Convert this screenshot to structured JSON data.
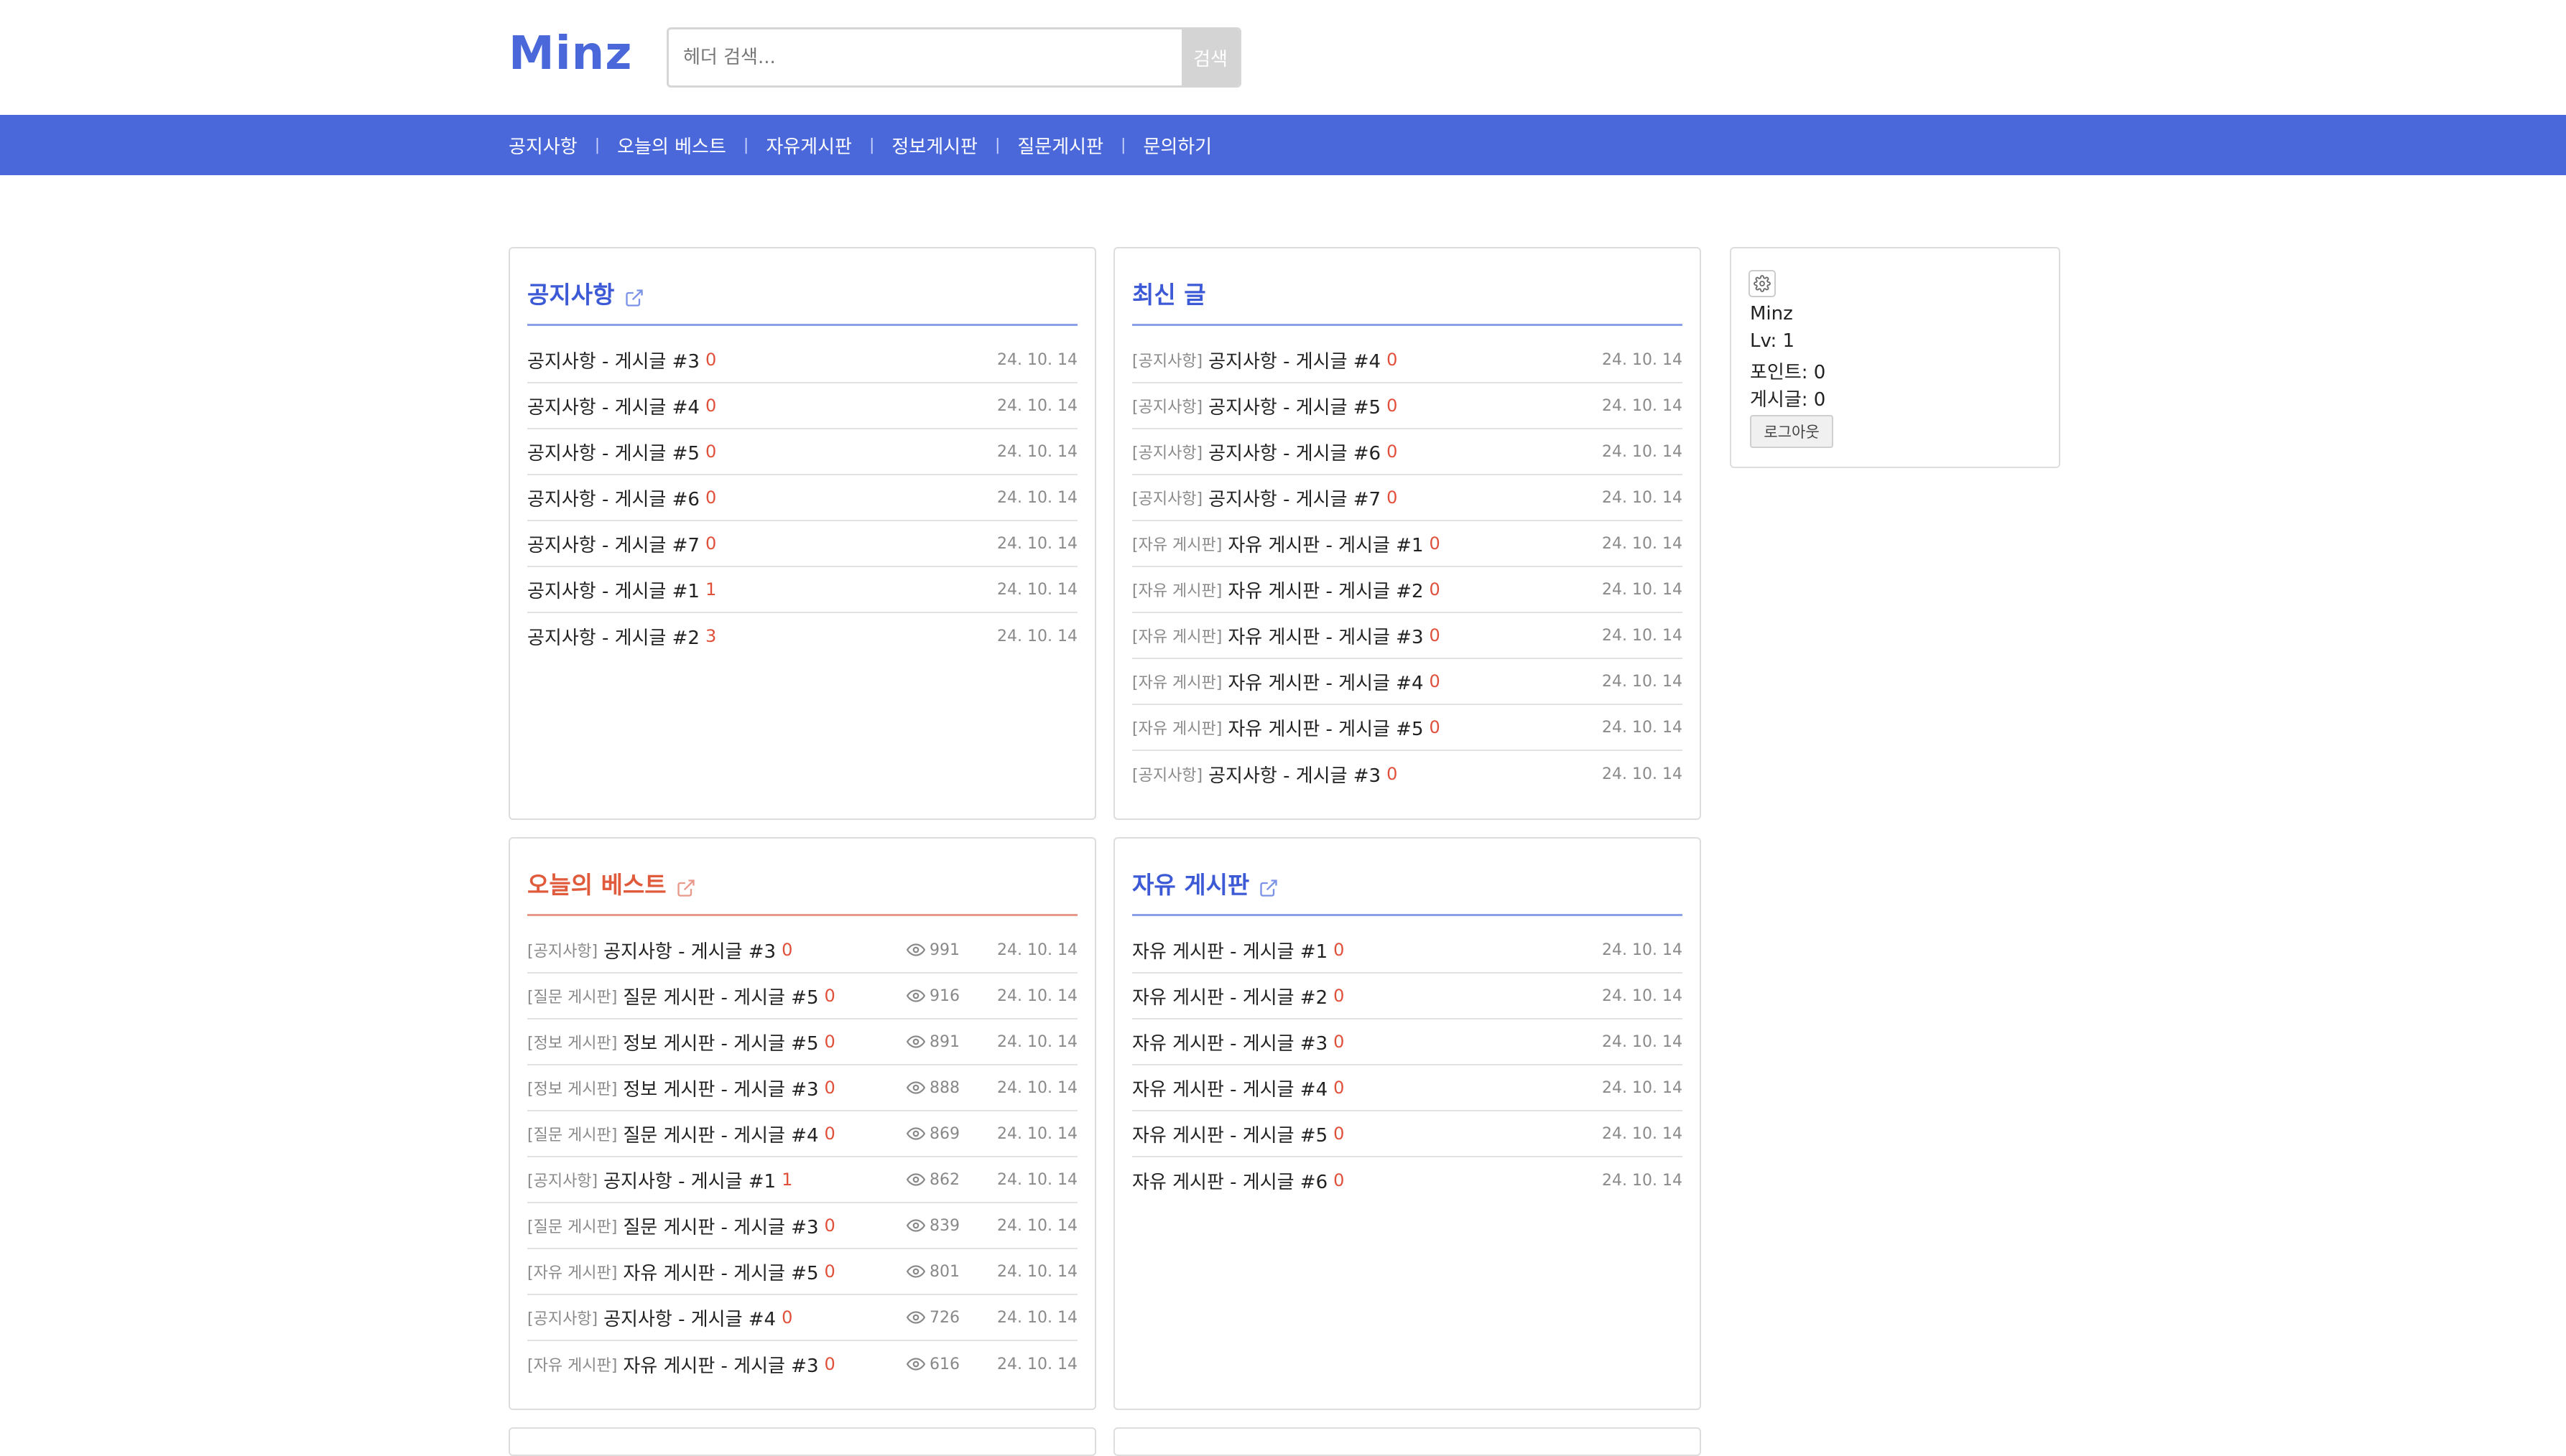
{
  "header": {
    "logo_text": "Minz",
    "search": {
      "placeholder": "헤더 검색...",
      "value": "",
      "button_label": "검색"
    }
  },
  "nav": {
    "items": [
      {
        "label": "공지사항"
      },
      {
        "label": "오늘의 베스트"
      },
      {
        "label": "자유게시판"
      },
      {
        "label": "정보게시판"
      },
      {
        "label": "질문게시판"
      },
      {
        "label": "문의하기"
      }
    ],
    "separator": "|"
  },
  "colors": {
    "brand": "#4a68da",
    "accent_title": "#3d5ad6",
    "best_title": "#e05a3c",
    "count": "#e0503a"
  },
  "notice": {
    "title": "공지사항",
    "posts": [
      {
        "title": "공지사항 - 게시글 #3",
        "comments": "0",
        "date": "24. 10. 14"
      },
      {
        "title": "공지사항 - 게시글 #4",
        "comments": "0",
        "date": "24. 10. 14"
      },
      {
        "title": "공지사항 - 게시글 #5",
        "comments": "0",
        "date": "24. 10. 14"
      },
      {
        "title": "공지사항 - 게시글 #6",
        "comments": "0",
        "date": "24. 10. 14"
      },
      {
        "title": "공지사항 - 게시글 #7",
        "comments": "0",
        "date": "24. 10. 14"
      },
      {
        "title": "공지사항 - 게시글 #1",
        "comments": "1",
        "date": "24. 10. 14"
      },
      {
        "title": "공지사항 - 게시글 #2",
        "comments": "3",
        "date": "24. 10. 14"
      }
    ]
  },
  "recent": {
    "title": "최신 글",
    "posts": [
      {
        "board": "[공지사항]",
        "title": "공지사항 - 게시글 #4",
        "comments": "0",
        "date": "24. 10. 14"
      },
      {
        "board": "[공지사항]",
        "title": "공지사항 - 게시글 #5",
        "comments": "0",
        "date": "24. 10. 14"
      },
      {
        "board": "[공지사항]",
        "title": "공지사항 - 게시글 #6",
        "comments": "0",
        "date": "24. 10. 14"
      },
      {
        "board": "[공지사항]",
        "title": "공지사항 - 게시글 #7",
        "comments": "0",
        "date": "24. 10. 14"
      },
      {
        "board": "[자유 게시판]",
        "title": "자유 게시판 - 게시글 #1",
        "comments": "0",
        "date": "24. 10. 14"
      },
      {
        "board": "[자유 게시판]",
        "title": "자유 게시판 - 게시글 #2",
        "comments": "0",
        "date": "24. 10. 14"
      },
      {
        "board": "[자유 게시판]",
        "title": "자유 게시판 - 게시글 #3",
        "comments": "0",
        "date": "24. 10. 14"
      },
      {
        "board": "[자유 게시판]",
        "title": "자유 게시판 - 게시글 #4",
        "comments": "0",
        "date": "24. 10. 14"
      },
      {
        "board": "[자유 게시판]",
        "title": "자유 게시판 - 게시글 #5",
        "comments": "0",
        "date": "24. 10. 14"
      },
      {
        "board": "[공지사항]",
        "title": "공지사항 - 게시글 #3",
        "comments": "0",
        "date": "24. 10. 14"
      }
    ]
  },
  "best": {
    "title": "오늘의 베스트",
    "posts": [
      {
        "board": "[공지사항]",
        "title": "공지사항 - 게시글 #3",
        "comments": "0",
        "views": "991",
        "date": "24. 10. 14"
      },
      {
        "board": "[질문 게시판]",
        "title": "질문 게시판 - 게시글 #5",
        "comments": "0",
        "views": "916",
        "date": "24. 10. 14"
      },
      {
        "board": "[정보 게시판]",
        "title": "정보 게시판 - 게시글 #5",
        "comments": "0",
        "views": "891",
        "date": "24. 10. 14"
      },
      {
        "board": "[정보 게시판]",
        "title": "정보 게시판 - 게시글 #3",
        "comments": "0",
        "views": "888",
        "date": "24. 10. 14"
      },
      {
        "board": "[질문 게시판]",
        "title": "질문 게시판 - 게시글 #4",
        "comments": "0",
        "views": "869",
        "date": "24. 10. 14"
      },
      {
        "board": "[공지사항]",
        "title": "공지사항 - 게시글 #1",
        "comments": "1",
        "views": "862",
        "date": "24. 10. 14"
      },
      {
        "board": "[질문 게시판]",
        "title": "질문 게시판 - 게시글 #3",
        "comments": "0",
        "views": "839",
        "date": "24. 10. 14"
      },
      {
        "board": "[자유 게시판]",
        "title": "자유 게시판 - 게시글 #5",
        "comments": "0",
        "views": "801",
        "date": "24. 10. 14"
      },
      {
        "board": "[공지사항]",
        "title": "공지사항 - 게시글 #4",
        "comments": "0",
        "views": "726",
        "date": "24. 10. 14"
      },
      {
        "board": "[자유 게시판]",
        "title": "자유 게시판 - 게시글 #3",
        "comments": "0",
        "views": "616",
        "date": "24. 10. 14"
      }
    ]
  },
  "free": {
    "title": "자유 게시판",
    "posts": [
      {
        "title": "자유 게시판 - 게시글 #1",
        "comments": "0",
        "date": "24. 10. 14"
      },
      {
        "title": "자유 게시판 - 게시글 #2",
        "comments": "0",
        "date": "24. 10. 14"
      },
      {
        "title": "자유 게시판 - 게시글 #3",
        "comments": "0",
        "date": "24. 10. 14"
      },
      {
        "title": "자유 게시판 - 게시글 #4",
        "comments": "0",
        "date": "24. 10. 14"
      },
      {
        "title": "자유 게시판 - 게시글 #5",
        "comments": "0",
        "date": "24. 10. 14"
      },
      {
        "title": "자유 게시판 - 게시글 #6",
        "comments": "0",
        "date": "24. 10. 14"
      }
    ]
  },
  "user": {
    "name": "Minz",
    "level": "Lv: 1",
    "points": "포인트: 0",
    "posts": "게시글: 0",
    "logout_label": "로그아웃"
  }
}
